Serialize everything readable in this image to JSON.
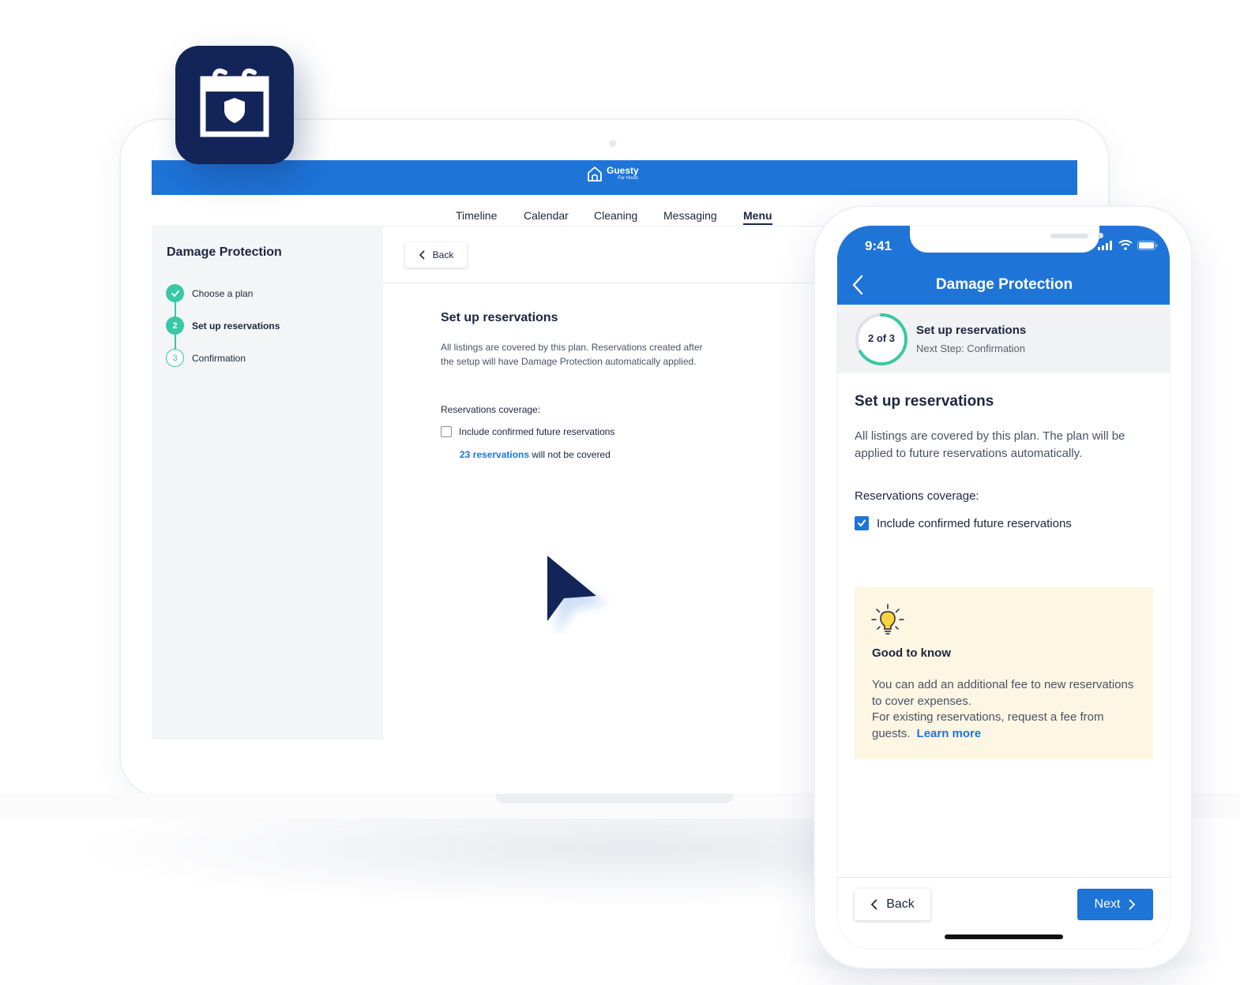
{
  "brand": {
    "name": "Guesty",
    "sub": "For Hosts",
    "primary_color": "#1f74d8",
    "navy": "#122458",
    "success_color": "#38c9a4"
  },
  "nav": {
    "items": [
      "Timeline",
      "Calendar",
      "Cleaning",
      "Messaging",
      "Menu"
    ],
    "active": "Menu"
  },
  "desktop": {
    "sidebar": {
      "title": "Damage Protection",
      "steps": [
        {
          "label": "Choose a plan",
          "number": "✓",
          "state": "done"
        },
        {
          "label": "Set up reservations",
          "number": "2",
          "state": "current"
        },
        {
          "label": "Confirmation",
          "number": "3",
          "state": "todo"
        }
      ]
    },
    "back_label": "Back",
    "title": "Set up reservations",
    "description": "All listings are covered by this plan. Reservations created after the setup will have Damage Protection automatically applied.",
    "coverage_label": "Reservations coverage:",
    "checkbox_label": "Include confirmed future reservations",
    "note_link": "23 reservations",
    "note_text": " will not be covered"
  },
  "phone": {
    "time": "9:41",
    "title": "Damage Protection",
    "progress": {
      "text": "2 of 3",
      "current": 2,
      "total": 3,
      "step_title": "Set up reservations",
      "next_step": "Next Step: Confirmation"
    },
    "heading": "Set up reservations",
    "description": "All listings are covered by this plan. The plan will be applied to future reservations automatically.",
    "coverage_label": "Reservations coverage:",
    "checkbox_label": "Include confirmed future reservations",
    "tip": {
      "title": "Good to know",
      "body_line1": "You can add an additional fee to new reservations to cover expenses.",
      "body_line2": "For existing reservations, request a fee from guests.",
      "link": "Learn more"
    },
    "back_label": "Back",
    "next_label": "Next"
  }
}
